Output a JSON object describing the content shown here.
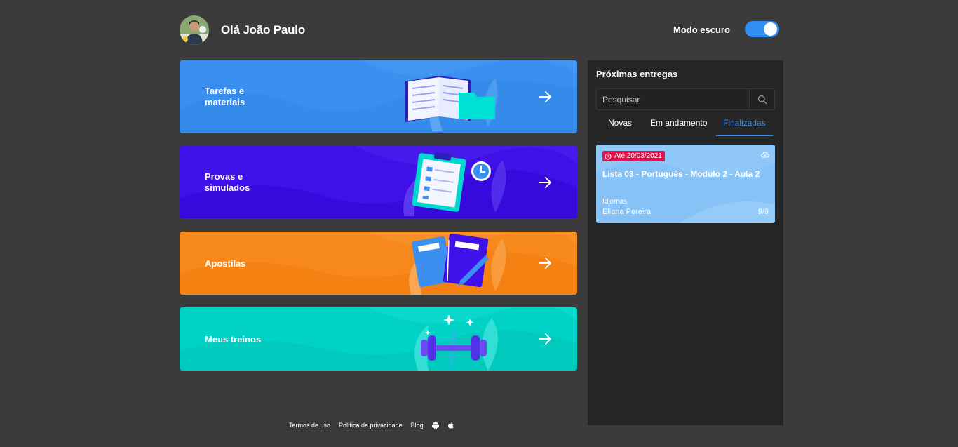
{
  "header": {
    "greeting": "Olá João Paulo",
    "dark_mode_label": "Modo escuro",
    "dark_mode_on": true
  },
  "cards": [
    {
      "label": "Tarefas e\nmateriais",
      "color": "#3b8ff0",
      "icon": "open-book-folder-illustration"
    },
    {
      "label": "Provas e\nsimulados",
      "color": "#3f10e8",
      "icon": "clipboard-clock-illustration"
    },
    {
      "label": "Apostilas",
      "color": "#f7891c",
      "icon": "notebooks-illustration"
    },
    {
      "label": "Meus treinos",
      "color": "#00d2c6",
      "icon": "dumbbell-illustration"
    }
  ],
  "panel": {
    "title": "Próximas entregas",
    "search_placeholder": "Pesquisar",
    "tabs": [
      "Novas",
      "Em andamento",
      "Finalizadas"
    ],
    "active_tab": "Finalizadas",
    "tasks": [
      {
        "due": "Até 20/03/2021",
        "title": "Lista 03 - Português - Modulo 2 - Aula 2",
        "subject": "Idiomas",
        "teacher": "Eliana Pereira",
        "count": "9/9"
      }
    ]
  },
  "footer": {
    "links": [
      "Termos de uso",
      "Política de privacidade",
      "Blog"
    ],
    "icons": [
      "android-icon",
      "apple-icon"
    ]
  },
  "colors": {
    "accent": "#2f8ef0",
    "badge": "#e8104e",
    "panel_bg": "#262626",
    "page_bg": "#3b3b3b"
  }
}
